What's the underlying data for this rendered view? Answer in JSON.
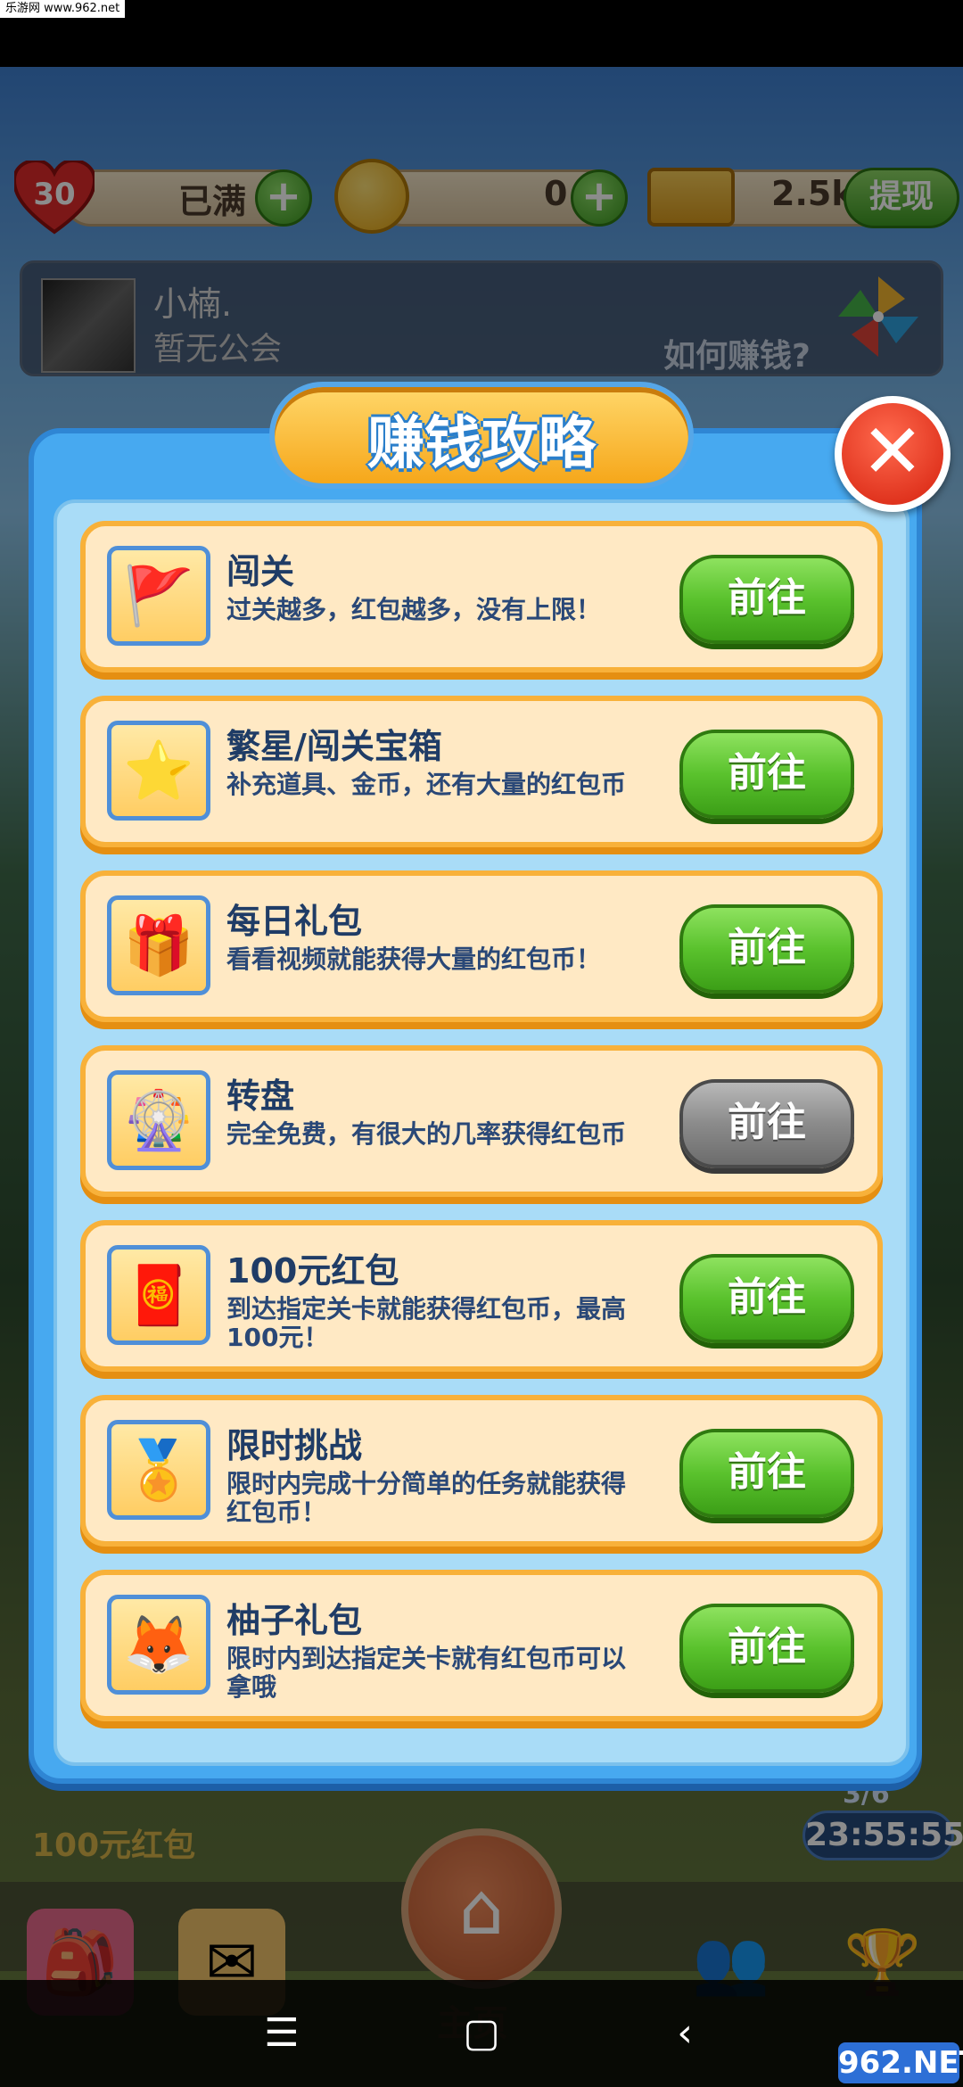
{
  "watermark_top": "乐游网 www.962.net",
  "resources": {
    "lives": "30",
    "lives_status": "已满",
    "paw_coins": "0",
    "cash": "2.5k",
    "withdraw_label": "提现",
    "plus_symbol": "+"
  },
  "profile": {
    "name": "小楠.",
    "guild": "暂无公会",
    "how_to_earn": "如何赚钱?"
  },
  "modal": {
    "title": "赚钱攻略",
    "close_symbol": "✕",
    "tasks": [
      {
        "title": "闯关",
        "desc": "过关越多，红包越多，没有上限！",
        "button": "前往",
        "icon": "flag-icon",
        "glyph": "🚩",
        "enabled": true
      },
      {
        "title": "繁星/闯关宝箱",
        "desc": "补充道具、金币，还有大量的红包币",
        "button": "前往",
        "icon": "star-icon",
        "glyph": "⭐",
        "enabled": true
      },
      {
        "title": "每日礼包",
        "desc": "看看视频就能获得大量的红包币！",
        "button": "前往",
        "icon": "gift-icon",
        "glyph": "🎁",
        "enabled": true
      },
      {
        "title": "转盘",
        "desc": "完全免费，有很大的几率获得红包币",
        "button": "前往",
        "icon": "wheel-icon",
        "glyph": "🎡",
        "enabled": false
      },
      {
        "title": "100元红包",
        "desc": "到达指定关卡就能获得红包币，最高100元！",
        "button": "前往",
        "icon": "red-envelope-icon",
        "glyph": "🧧",
        "enabled": true
      },
      {
        "title": "限时挑战",
        "desc": "限时内完成十分简单的任务就能获得红包币！",
        "button": "前往",
        "icon": "medal-icon",
        "glyph": "🏅",
        "enabled": true
      },
      {
        "title": "柚子礼包",
        "desc": "限时内到达指定关卡就有红包币可以拿哦",
        "button": "前往",
        "icon": "fox-icon",
        "glyph": "🦊",
        "enabled": true
      }
    ]
  },
  "background": {
    "hongbao_label": "100元红包",
    "progress": "3/6",
    "timer": "23:55:55",
    "home_label": "主页"
  },
  "system_nav": {
    "menu": "☰",
    "home": "▢",
    "back": "‹"
  },
  "watermark_bottom": "962.NET"
}
